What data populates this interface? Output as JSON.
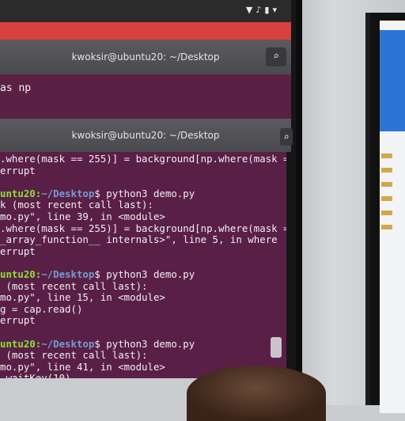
{
  "window_title": "kwoksir@ubuntu20: ~/Desktop",
  "window_title_2": "kwoksir@ubuntu20: ~/Desktop",
  "tray_icons": [
    "wifi-icon",
    "volume-icon",
    "battery-icon",
    "dropdown-icon"
  ],
  "window1_line": "as np",
  "terminal_lines": [
    {
      "type": "text",
      "text": ".where(mask == 255)] = background[np.where(mask =="
    },
    {
      "type": "text",
      "text": "errupt"
    },
    {
      "type": "blank",
      "text": ""
    },
    {
      "type": "prompt",
      "user": "untu20",
      "path": "~/Desktop",
      "cmd": "$ python3 demo.py"
    },
    {
      "type": "text",
      "text": "k (most recent call last):"
    },
    {
      "type": "text",
      "text": "mo.py\", line 39, in <module>"
    },
    {
      "type": "text",
      "text": ".where(mask == 255)] = background[np.where(mask =="
    },
    {
      "type": "text",
      "text": "_array_function__ internals>\", line 5, in where"
    },
    {
      "type": "text",
      "text": "errupt"
    },
    {
      "type": "blank",
      "text": ""
    },
    {
      "type": "prompt",
      "user": "untu20",
      "path": "~/Desktop",
      "cmd": "$ python3 demo.py"
    },
    {
      "type": "text",
      "text": " (most recent call last):"
    },
    {
      "type": "text",
      "text": "mo.py\", line 15, in <module>"
    },
    {
      "type": "text",
      "text": "g = cap.read()"
    },
    {
      "type": "text",
      "text": "errupt"
    },
    {
      "type": "blank",
      "text": ""
    },
    {
      "type": "prompt",
      "user": "untu20",
      "path": "~/Desktop",
      "cmd": "$ python3 demo.py"
    },
    {
      "type": "text",
      "text": " (most recent call last):"
    },
    {
      "type": "text",
      "text": "mo.py\", line 41, in <module>"
    },
    {
      "type": "text",
      "text": ".waitKey(10)"
    }
  ]
}
